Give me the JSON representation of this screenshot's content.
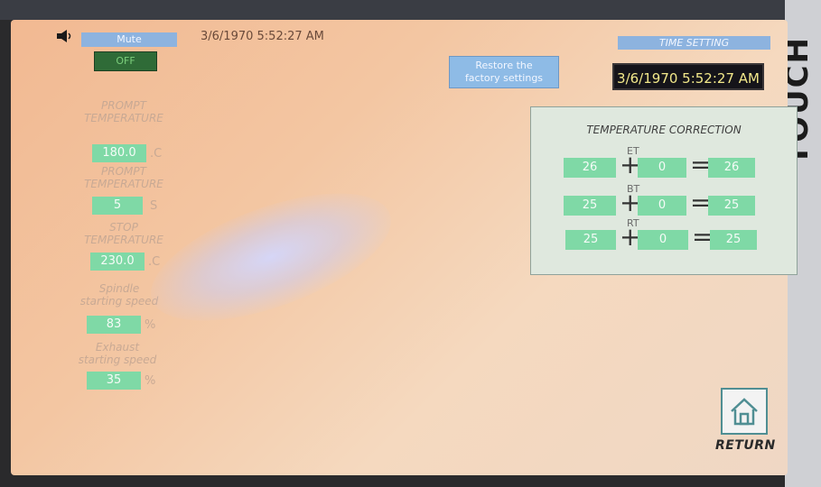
{
  "brand_text": "TOUCH",
  "header": {
    "mute_label": "Mute",
    "off_label": "OFF",
    "clock_text": "3/6/1970 5:52:27 AM",
    "restore_line1": "Restore the",
    "restore_line2": "factory settings",
    "time_setting_label": "TIME SETTING",
    "time_display": "3/6/1970 5:52:27 AM"
  },
  "left": {
    "prompt_temp_title_1": {
      "line1": "PROMPT",
      "line2": "TEMPERATURE"
    },
    "prompt_temp_value": "180.0",
    "prompt_temp_unit": ".C",
    "prompt_temp_title_2": {
      "line1": "PROMPT",
      "line2": "TEMPERATURE"
    },
    "prompt_time_value": "5",
    "prompt_time_unit": "S",
    "stop_temp_title": {
      "line1": "STOP",
      "line2": "TEMPERATURE"
    },
    "stop_temp_value": "230.0",
    "stop_temp_unit": ".C",
    "spindle_title": {
      "line1": "Spindle",
      "line2": "starting speed"
    },
    "spindle_value": "83",
    "spindle_unit": "%",
    "exhaust_title": {
      "line1": "Exhaust",
      "line2": "starting speed"
    },
    "exhaust_value": "35",
    "exhaust_unit": "%"
  },
  "correction": {
    "title": "TEMPERATURE CORRECTION",
    "plus": "+",
    "equals": "=",
    "rows": [
      {
        "label": "ET",
        "base": "26",
        "offset": "0",
        "result": "26"
      },
      {
        "label": "BT",
        "base": "25",
        "offset": "0",
        "result": "25"
      },
      {
        "label": "RT",
        "base": "25",
        "offset": "0",
        "result": "25"
      }
    ]
  },
  "footer": {
    "return_label": "RETURN"
  },
  "colors": {
    "screen_bg": "#f3c6a2",
    "field_green": "#7fd9a6",
    "label_blue": "#8db3df",
    "clock_bg": "#15141a",
    "clock_text": "#f2e88a"
  },
  "icons": {
    "speaker": "speaker-icon",
    "home": "home-icon"
  }
}
